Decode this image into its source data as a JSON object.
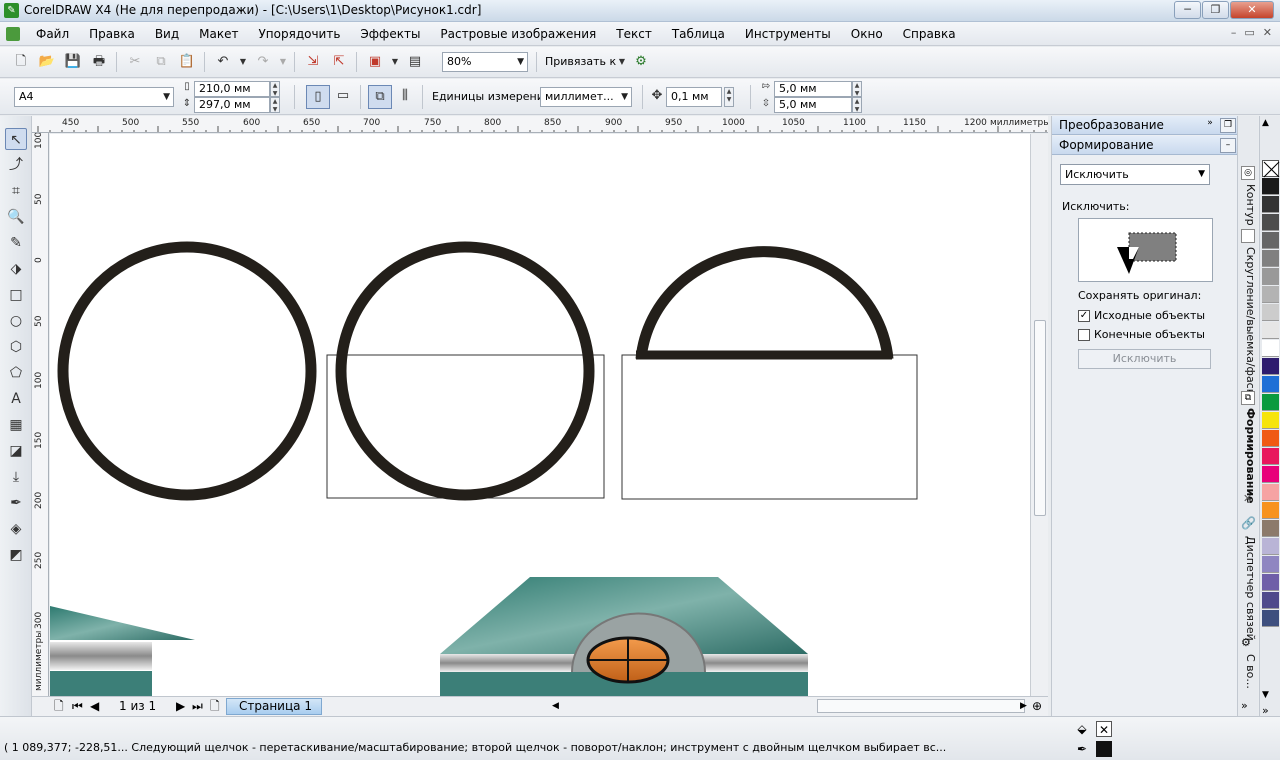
{
  "window": {
    "title": "CorelDRAW X4 (Не для перепродажи) - [C:\\Users\\1\\Desktop\\Рисунок1.cdr]",
    "minimize": "─",
    "restore": "❐",
    "close": "✕"
  },
  "menu": {
    "items": [
      "Файл",
      "Правка",
      "Вид",
      "Макет",
      "Упорядочить",
      "Эффекты",
      "Растровые изображения",
      "Текст",
      "Таблица",
      "Инструменты",
      "Окно",
      "Справка"
    ],
    "doc_controls": [
      "–",
      "▭",
      "✕"
    ]
  },
  "toolbar1": {
    "zoom_value": "80%",
    "snap_label": "Привязать к"
  },
  "toolbar2": {
    "page_size": "A4",
    "width": "210,0 мм",
    "height": "297,0 мм",
    "units_label": "Единицы измерения:",
    "units_value": "миллимет...",
    "nudge": "0,1 мм",
    "dup_x": "5,0 мм",
    "dup_y": "5,0 мм"
  },
  "ruler": {
    "h_labels": [
      "450",
      "500",
      "550",
      "600",
      "650",
      "700",
      "750",
      "800",
      "850",
      "900",
      "950",
      "1000",
      "1050",
      "1100",
      "1150",
      "1200"
    ],
    "h_units": "миллиметры",
    "v_labels": [
      "100",
      "50",
      "0",
      "50",
      "100",
      "150",
      "200",
      "250",
      "300"
    ],
    "v_units": "миллиметры"
  },
  "pagenav": {
    "page_count": "1 из 1",
    "page_tab": "Страница 1"
  },
  "docker": {
    "panel1_title": "Преобразование",
    "panel2_title": "Формирование",
    "operation": "Исключить",
    "operation_label": "Исключить:",
    "keep_original": "Сохранять оригинал:",
    "source_objects": "Исходные объекты",
    "target_objects": "Конечные объекты",
    "source_checked": true,
    "target_checked": false,
    "apply_button": "Исключить"
  },
  "vtabs": {
    "contour": "Контур",
    "fillet": "Скругление/выемка/фаска",
    "shaping": "Формирование",
    "links": "Диспетчер связей",
    "other": "С во..."
  },
  "palette": {
    "colors": [
      "#1a1a1a",
      "#333333",
      "#4d4d4d",
      "#666666",
      "#808080",
      "#999999",
      "#b3b3b3",
      "#cccccc",
      "#e6e6e6",
      "#ffffff",
      "#2e1c6e",
      "#1f6fd6",
      "#0a9a3e",
      "#f6e40c",
      "#f05a14",
      "#e8175d",
      "#e8007a",
      "#f6a3a3",
      "#f7931e",
      "#8c7a6b",
      "#b9b4d6",
      "#8f86c1",
      "#6f5fa8",
      "#4f4a8b",
      "#3e4f7e"
    ]
  },
  "status": {
    "text": "( 1 089,377; -228,51... Следующий щелчок - перетаскивание/масштабирование; второй щелчок - поворот/наклон; инструмент с двойным щелчком выбирает вс..."
  }
}
